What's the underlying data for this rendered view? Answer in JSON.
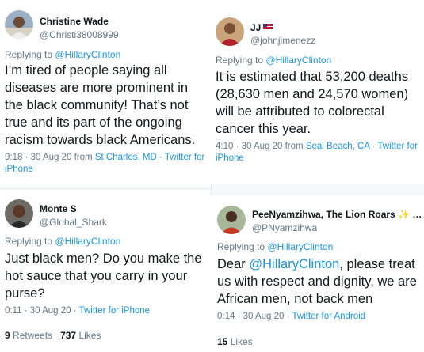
{
  "colors": {
    "link": "#1b95e0",
    "muted": "#657786",
    "text": "#14171a"
  },
  "tweets": [
    {
      "name": "Christine Wade",
      "handle": "@Christi38008999",
      "replying_label": "Replying to",
      "replying_to": "@HillaryClinton",
      "text": "I’m tired of people saying all diseases are more prominent in the black community!  That’s not true and its part of the ongoing racism towards black Americans.",
      "time": "9:18 · 30 Aug 20 from",
      "location": "St Charles, MD",
      "sep": "·",
      "client": "Twitter for iPhone"
    },
    {
      "name": "JJ",
      "flag_icon": "us-flag-icon",
      "handle": "@johnjimenezz",
      "replying_label": "Replying to",
      "replying_to": "@HillaryClinton",
      "text": "It is estimated that 53,200 deaths (28,630 men and 24,570 women) will be attributed to colorectal cancer this year.",
      "time": "4:10 · 30 Aug 20 from",
      "location": "Seal Beach, CA",
      "sep": "·",
      "client": "Twitter for iPhone"
    },
    {
      "name": "Monte S",
      "handle": "@Global_Shark",
      "replying_label": "Replying to",
      "replying_to": "@HillaryClinton",
      "text": "Just black men? Do you make the hot sauce that you carry in your purse?",
      "time": "0:11 · 30 Aug 20 ·",
      "client": "Twitter for iPhone",
      "retweets_count": "9",
      "retweets_label": "Retweets",
      "likes_count": "737",
      "likes_label": "Likes"
    },
    {
      "name": "PeeNyamzihwa, The Lion Roars",
      "name_suffix": "…",
      "handle": "@PNyamzihwa",
      "replying_label": "Replying to",
      "replying_to": "@HillaryClinton",
      "text_prefix": "Dear",
      "text_mention": "@HillaryClinton",
      "text_rest": ", please treat us with respect and dignity, we are African men, not back men",
      "time": "0:14 · 30 Aug 20 ·",
      "client": "Twitter for Android",
      "likes_count": "15",
      "likes_label": "Likes"
    }
  ]
}
